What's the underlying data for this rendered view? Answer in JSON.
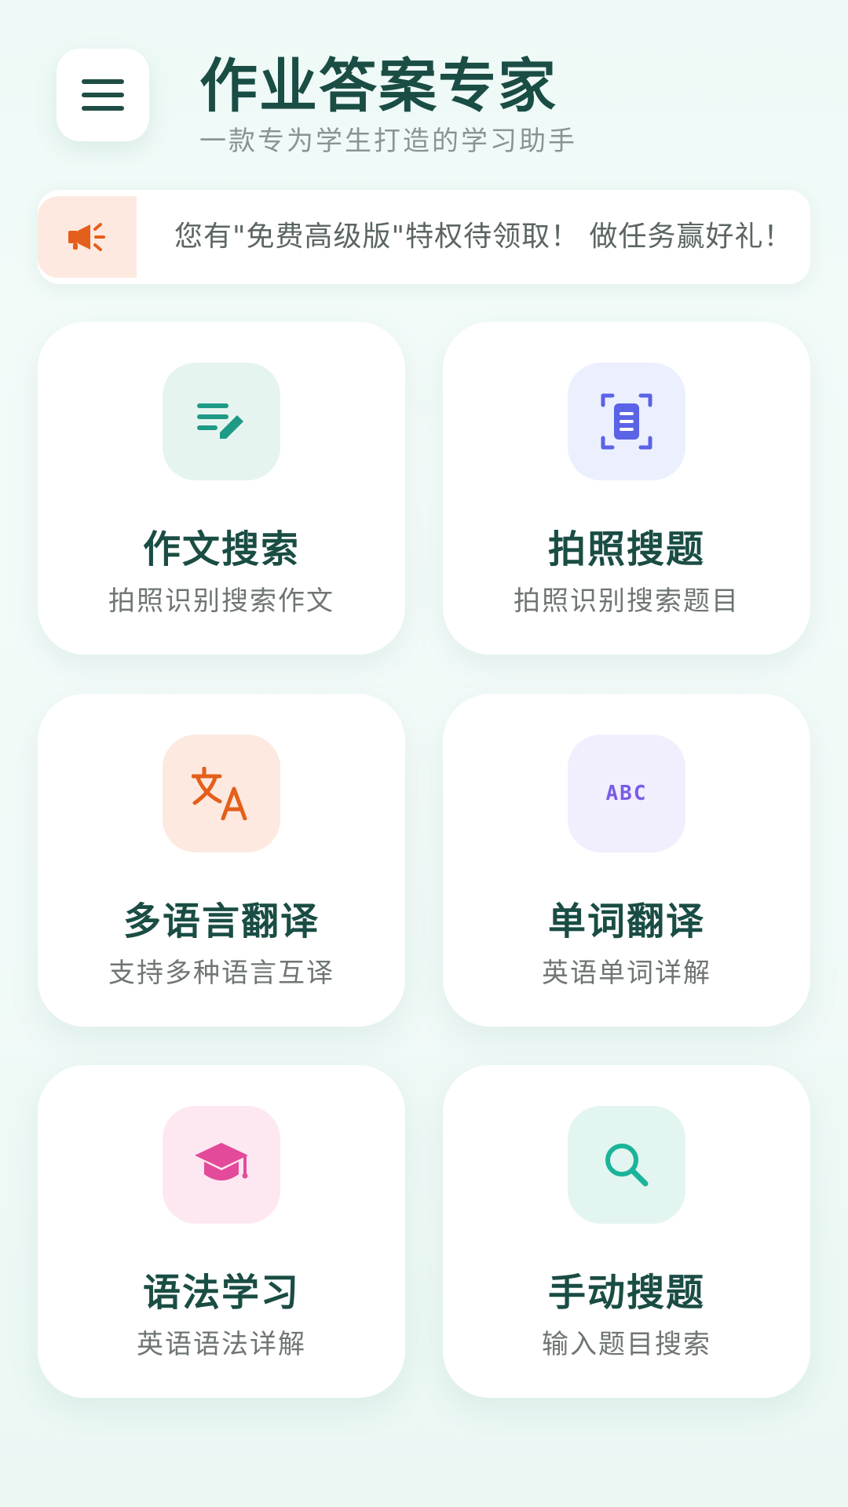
{
  "header": {
    "title": "作业答案专家",
    "subtitle": "一款专为学生打造的学习助手"
  },
  "notice": {
    "text": "您有\"免费高级版\"特权待领取！ 做任务赢好礼！"
  },
  "cards": [
    {
      "title": "作文搜索",
      "desc": "拍照识别搜索作文",
      "icon": "essay-edit-icon",
      "bg": "#e6f4f0",
      "color": "#1f9a86"
    },
    {
      "title": "拍照搜题",
      "desc": "拍照识别搜索题目",
      "icon": "scan-document-icon",
      "bg": "#eceffe",
      "color": "#5b63e6"
    },
    {
      "title": "多语言翻译",
      "desc": "支持多种语言互译",
      "icon": "translate-icon",
      "bg": "#fde9df",
      "color": "#e45f1b"
    },
    {
      "title": "单词翻译",
      "desc": "英语单词详解",
      "icon": "abc-icon",
      "icon_text": "ABC",
      "bg": "#f1eefe",
      "color": "#7a5ae6"
    },
    {
      "title": "语法学习",
      "desc": "英语语法详解",
      "icon": "graduation-cap-icon",
      "bg": "#fde8f1",
      "color": "#e34a9a"
    },
    {
      "title": "手动搜题",
      "desc": "输入题目搜索",
      "icon": "search-icon",
      "bg": "#e3f5f0",
      "color": "#19b49a"
    }
  ],
  "colors": {
    "primary_text": "#1a4d44",
    "notice_accent": "#e45f1b"
  }
}
